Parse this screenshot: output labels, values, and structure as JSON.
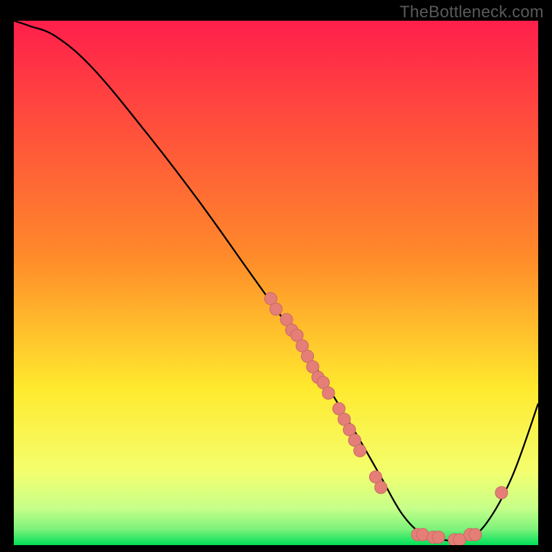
{
  "watermark": "TheBottleneck.com",
  "colors": {
    "bg_black": "#000000",
    "curve": "#000000",
    "dot_fill": "#e47e76",
    "dot_stroke": "#c96a63",
    "gradient_top": "#ff1f4b",
    "gradient_mid": "#ffd500",
    "gradient_green_pale": "#d6ff9e",
    "gradient_green": "#00e05a"
  },
  "chart_data": {
    "type": "line",
    "title": "",
    "xlabel": "",
    "ylabel": "",
    "xlim": [
      0,
      100
    ],
    "ylim": [
      0,
      100
    ],
    "curve": {
      "x": [
        0,
        3,
        8,
        15,
        25,
        35,
        45,
        50,
        55,
        60,
        63,
        66,
        70,
        74,
        78,
        82,
        86,
        90,
        95,
        100
      ],
      "y": [
        100,
        99,
        97,
        91,
        79,
        66,
        52,
        45,
        38,
        30,
        25,
        20,
        13,
        6,
        2,
        1,
        1,
        4,
        13,
        27
      ]
    },
    "series": [
      {
        "name": "dots",
        "points": [
          {
            "x": 49,
            "y": 47
          },
          {
            "x": 50,
            "y": 45
          },
          {
            "x": 52,
            "y": 43
          },
          {
            "x": 53,
            "y": 41
          },
          {
            "x": 54,
            "y": 40
          },
          {
            "x": 55,
            "y": 38
          },
          {
            "x": 56,
            "y": 36
          },
          {
            "x": 57,
            "y": 34
          },
          {
            "x": 58,
            "y": 32
          },
          {
            "x": 59,
            "y": 31
          },
          {
            "x": 60,
            "y": 29
          },
          {
            "x": 62,
            "y": 26
          },
          {
            "x": 63,
            "y": 24
          },
          {
            "x": 64,
            "y": 22
          },
          {
            "x": 65,
            "y": 20
          },
          {
            "x": 66,
            "y": 18
          },
          {
            "x": 69,
            "y": 13
          },
          {
            "x": 70,
            "y": 11
          },
          {
            "x": 77,
            "y": 2
          },
          {
            "x": 78,
            "y": 2
          },
          {
            "x": 80,
            "y": 1.5
          },
          {
            "x": 81,
            "y": 1.5
          },
          {
            "x": 84,
            "y": 1
          },
          {
            "x": 85,
            "y": 1
          },
          {
            "x": 87,
            "y": 2
          },
          {
            "x": 88,
            "y": 2
          },
          {
            "x": 93,
            "y": 10
          }
        ]
      }
    ]
  }
}
